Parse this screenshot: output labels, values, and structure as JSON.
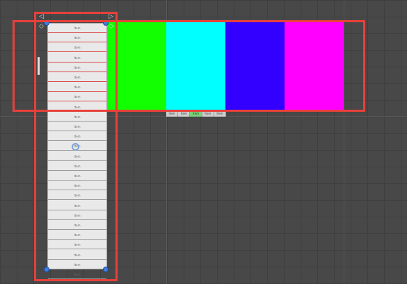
{
  "canvas": {
    "background": "#484848"
  },
  "color_strip": {
    "colors": [
      "#11ff00",
      "#00ffff",
      "#3300ff",
      "#ff00ff"
    ]
  },
  "tabs": {
    "labels": [
      "Item",
      "Item",
      "Item",
      "Item",
      "Item"
    ],
    "active_index": 2
  },
  "list": {
    "row_label": "Item",
    "rows": [
      "Item",
      "Item",
      "Item",
      "Item",
      "Item",
      "Item",
      "Item",
      "Item",
      "Item",
      "Item",
      "Item",
      "Item",
      "Item",
      "Item",
      "Item",
      "Item",
      "Item",
      "Item",
      "Item",
      "Item",
      "Item",
      "Item",
      "Item",
      "Item",
      "Item",
      "Item"
    ],
    "selected_rows": [
      0,
      1,
      2,
      3,
      4,
      5,
      6,
      7
    ]
  },
  "highlight_color": "#e8403a"
}
